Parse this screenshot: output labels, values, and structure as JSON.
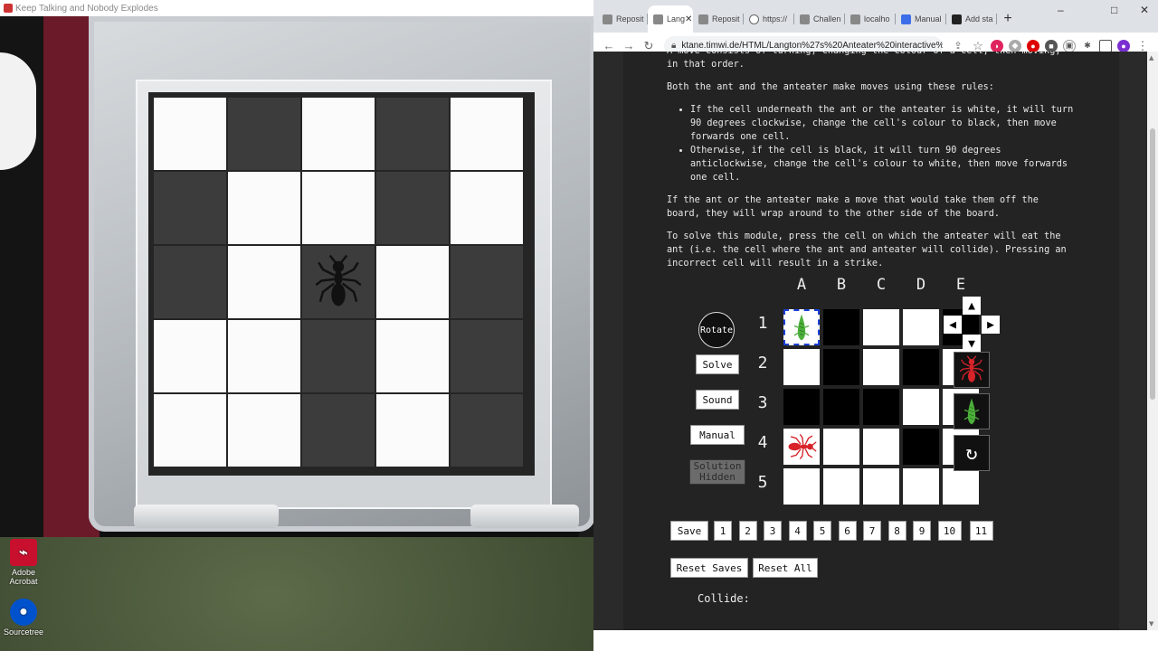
{
  "game": {
    "window_title": "Keep Talking and Nobody Explodes",
    "board": [
      [
        "white",
        "dark",
        "white",
        "dark",
        "white"
      ],
      [
        "dark",
        "white",
        "white",
        "dark",
        "white"
      ],
      [
        "dark",
        "white",
        "ant",
        "white",
        "dark"
      ],
      [
        "white",
        "white",
        "dark",
        "white",
        "dark"
      ],
      [
        "white",
        "white",
        "dark",
        "white",
        "dark"
      ]
    ]
  },
  "desktop": {
    "icons": [
      {
        "label": "Adobe\nAcrobat",
        "icon": "adobe-acrobat-icon",
        "color": "#c8102e"
      },
      {
        "label": "Sourcetree",
        "icon": "sourcetree-icon",
        "color": "#0052cc"
      }
    ]
  },
  "browser": {
    "tabs": [
      {
        "label": "Reposit",
        "icon": "page-icon"
      },
      {
        "label": "Lang",
        "icon": "page-icon",
        "active": true
      },
      {
        "label": "Reposit",
        "icon": "page-icon"
      },
      {
        "label": "https://",
        "icon": "globe-icon"
      },
      {
        "label": "Challen",
        "icon": "page-icon"
      },
      {
        "label": "localho",
        "icon": "page-icon"
      },
      {
        "label": "Manual",
        "icon": "doc-icon"
      },
      {
        "label": "Add sta",
        "icon": "github-icon"
      }
    ],
    "new_tab": "+",
    "url": "ktane.timwi.de/HTML/Langton%27s%20Anteater%20interactive%2...",
    "window_controls": {
      "minimize": "–",
      "maximize": "□",
      "close": "✕"
    }
  },
  "page": {
    "intro_cut": "A move consists of turning, changing the colour of a cell, then moving, in that order.",
    "rules_intro": "Both the ant and the anteater make moves using these rules:",
    "rules": [
      "If the cell underneath the ant or the anteater is white, it will turn 90 degrees clockwise, change the cell's colour to black, then move forwards one cell.",
      "Otherwise, if the cell is black, it will turn 90 degrees anticlockwise, change the cell's colour to white, then move forwards one cell."
    ],
    "wrap_text": "If the ant or the anteater make a move that would take them off the board, they will wrap around to the other side of the board.",
    "solve_text": "To solve this module, press the cell on which the anteater will eat the ant (i.e. the cell where the ant and anteater will collide). Pressing an incorrect cell will result in a strike.",
    "columns": [
      "A",
      "B",
      "C",
      "D",
      "E"
    ],
    "rows": [
      "1",
      "2",
      "3",
      "4",
      "5"
    ],
    "grid": [
      [
        "anteater",
        "b",
        "w",
        "w",
        "b"
      ],
      [
        "w",
        "b",
        "w",
        "b",
        "w"
      ],
      [
        "b",
        "b",
        "b",
        "w",
        "w"
      ],
      [
        "ant",
        "w",
        "w",
        "b",
        "w"
      ],
      [
        "w",
        "w",
        "w",
        "w",
        "w"
      ]
    ],
    "selected_cell": "A1",
    "buttons": {
      "rotate": "Rotate",
      "solve": "Solve",
      "sound": "Sound",
      "manual": "Manual",
      "solution_hidden": "Solution Hidden",
      "save": "Save",
      "reset_saves": "Reset Saves",
      "reset_all": "Reset All"
    },
    "save_slots": [
      "1",
      "2",
      "3",
      "4",
      "5",
      "6",
      "7",
      "8",
      "9",
      "10",
      "11"
    ],
    "arrows": {
      "up": "▲",
      "left": "◀",
      "right": "▶",
      "down": "▼"
    },
    "side_tools": [
      "ant-icon",
      "anteater-icon",
      "rotate-icon"
    ],
    "collide_label": "Collide:",
    "colors": {
      "ant": "#d8232a",
      "anteater": "#4caf3a",
      "selection": "#1a3fd6"
    }
  }
}
